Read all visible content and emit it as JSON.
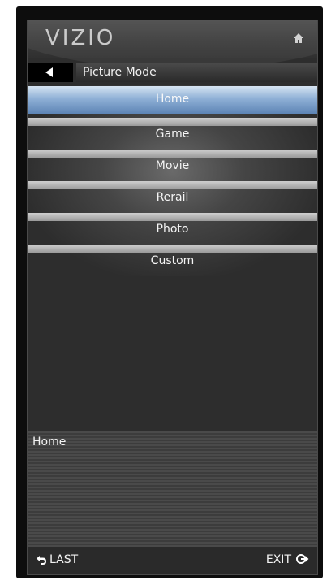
{
  "header": {
    "logo_text": "VIZIO",
    "home_icon": "home-icon"
  },
  "titlebar": {
    "back_icon": "back-arrow-icon",
    "title": "Picture Mode"
  },
  "menu": {
    "selected_index": 0,
    "items": [
      {
        "label": "Home"
      },
      {
        "label": "Game"
      },
      {
        "label": "Movie"
      },
      {
        "label": "Rerail"
      },
      {
        "label": "Photo"
      },
      {
        "label": "Custom"
      }
    ]
  },
  "description": {
    "text": "Home"
  },
  "footer": {
    "last_label": "LAST",
    "last_icon": "return-icon",
    "exit_label": "EXIT",
    "exit_icon": "exit-icon"
  },
  "colors": {
    "selected_highlight": "#7fa3cf",
    "panel_background": "#2d2d2d"
  }
}
